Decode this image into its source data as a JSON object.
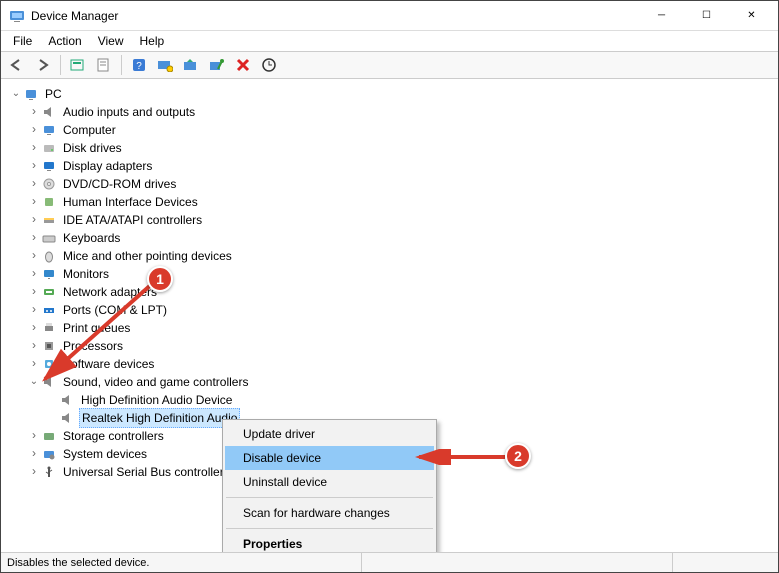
{
  "titlebar": {
    "title": "Device Manager"
  },
  "menubar": {
    "items": [
      "File",
      "Action",
      "View",
      "Help"
    ]
  },
  "tree": {
    "root": "PC",
    "nodes": [
      {
        "label": "Audio inputs and outputs",
        "icon": "speaker",
        "state": "collapsed"
      },
      {
        "label": "Computer",
        "icon": "computer",
        "state": "collapsed"
      },
      {
        "label": "Disk drives",
        "icon": "disk",
        "state": "collapsed"
      },
      {
        "label": "Display adapters",
        "icon": "display",
        "state": "collapsed"
      },
      {
        "label": "DVD/CD-ROM drives",
        "icon": "cd",
        "state": "collapsed"
      },
      {
        "label": "Human Interface Devices",
        "icon": "hid",
        "state": "collapsed"
      },
      {
        "label": "IDE ATA/ATAPI controllers",
        "icon": "ide",
        "state": "collapsed"
      },
      {
        "label": "Keyboards",
        "icon": "keyboard",
        "state": "collapsed"
      },
      {
        "label": "Mice and other pointing devices",
        "icon": "mouse",
        "state": "collapsed"
      },
      {
        "label": "Monitors",
        "icon": "monitor",
        "state": "collapsed"
      },
      {
        "label": "Network adapters",
        "icon": "network",
        "state": "collapsed"
      },
      {
        "label": "Ports (COM & LPT)",
        "icon": "port",
        "state": "collapsed"
      },
      {
        "label": "Print queues",
        "icon": "printer",
        "state": "collapsed"
      },
      {
        "label": "Processors",
        "icon": "cpu",
        "state": "collapsed"
      },
      {
        "label": "Software devices",
        "icon": "software",
        "state": "collapsed"
      },
      {
        "label": "Sound, video and game controllers",
        "icon": "speaker",
        "state": "expanded",
        "children": [
          {
            "label": "High Definition Audio Device",
            "icon": "speaker"
          },
          {
            "label": "Realtek High Definition Audio",
            "icon": "speaker",
            "selected": true
          }
        ]
      },
      {
        "label": "Storage controllers",
        "icon": "storage",
        "state": "collapsed"
      },
      {
        "label": "System devices",
        "icon": "system",
        "state": "collapsed"
      },
      {
        "label": "Universal Serial Bus controllers",
        "icon": "usb",
        "state": "collapsed"
      }
    ]
  },
  "context_menu": {
    "items": [
      {
        "label": "Update driver"
      },
      {
        "label": "Disable device",
        "hover": true
      },
      {
        "label": "Uninstall device"
      },
      {
        "sep": true
      },
      {
        "label": "Scan for hardware changes"
      },
      {
        "sep": true
      },
      {
        "label": "Properties",
        "bold": true
      }
    ]
  },
  "statusbar": {
    "text": "Disables the selected device."
  },
  "annotations": {
    "badge1": "1",
    "badge2": "2"
  }
}
